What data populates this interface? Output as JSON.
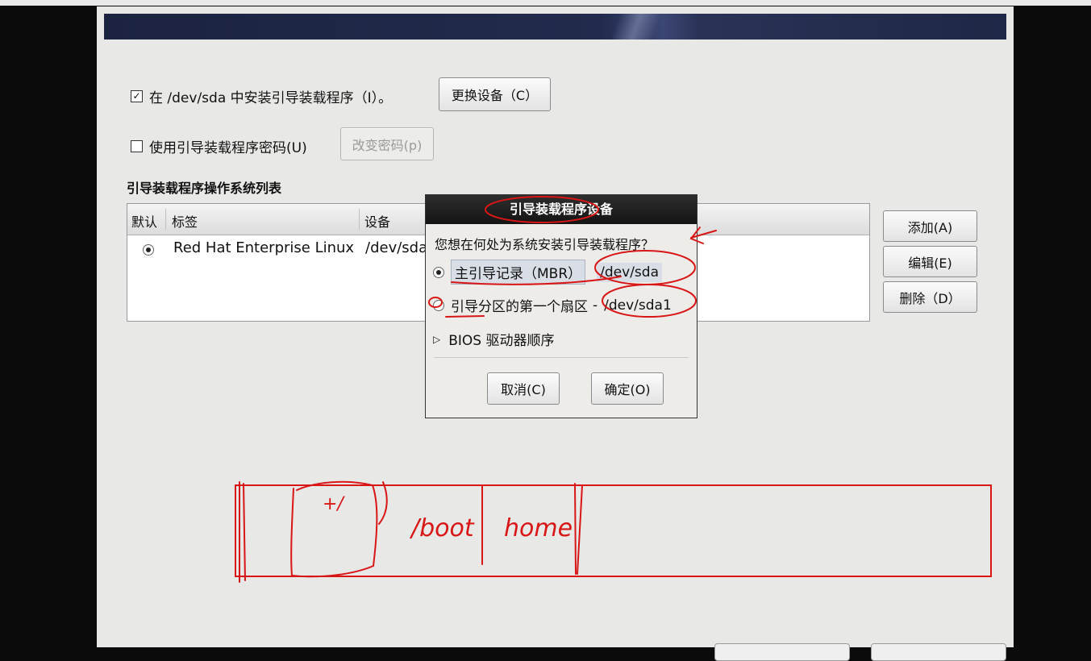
{
  "install_loader": {
    "label": "在 /dev/sda 中安装引导装载程序（I）。",
    "checked": true
  },
  "change_device_button": "更换设备（C）",
  "use_password": {
    "label": "使用引导装载程序密码(U)",
    "checked": false
  },
  "change_password_button": "改变密码(p)",
  "os_list": {
    "title": "引导装载程序操作系统列表",
    "columns": [
      "默认",
      "标签",
      "设备"
    ],
    "rows": [
      {
        "default": true,
        "label": "Red Hat Enterprise Linux",
        "device": "/dev/sda"
      }
    ]
  },
  "side_buttons": {
    "add": "添加(A)",
    "edit": "编辑(E)",
    "delete": "删除（D）"
  },
  "dialog": {
    "title": "引导装载程序设备",
    "question": "您想在何处为系统安装引导装载程序？",
    "options": [
      {
        "label": "主引导记录（MBR）",
        "device": "/dev/sda",
        "selected": true
      },
      {
        "label": "引导分区的第一个扇区",
        "device": "/dev/sda1",
        "selected": false
      }
    ],
    "bios_order": "BIOS 驱动器顺序",
    "cancel_button": "取消(C)",
    "ok_button": "确定(O)"
  },
  "annotation_text": {
    "slot1": "+/",
    "slot2": "/boot",
    "slot3": "home"
  },
  "colors": {
    "annotation": "#d81616",
    "banner": "#1f2747"
  }
}
